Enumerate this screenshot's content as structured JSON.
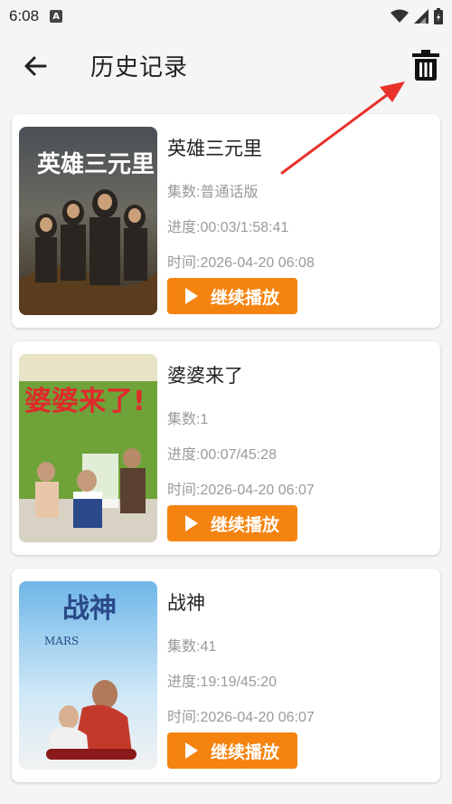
{
  "status_bar": {
    "time": "6:08",
    "notification_icon_letter": "A",
    "icons": [
      "wifi-icon",
      "signal-icon",
      "battery-icon"
    ]
  },
  "header": {
    "back_icon": "arrow-left-icon",
    "title": "历史记录",
    "delete_icon": "trash-icon"
  },
  "colors": {
    "accent": "#f5830f",
    "annotation_arrow": "#e8312b",
    "meta_text": "#9a9a9a",
    "title_text": "#222222"
  },
  "history": [
    {
      "title": "英雄三元里",
      "episodes": "集数:普通话版",
      "progress": "进度:00:03/1:58:41",
      "time": "时间:2026-04-20 06:08",
      "button_label": "继续播放",
      "poster_text": "英雄三元里"
    },
    {
      "title": "婆婆来了",
      "episodes": "集数:1",
      "progress": "进度:00:07/45:28",
      "time": "时间:2026-04-20 06:07",
      "button_label": "继续播放",
      "poster_text": "婆婆来了!"
    },
    {
      "title": "战神",
      "episodes": "集数:41",
      "progress": "进度:19:19/45:20",
      "time": "时间:2026-04-20 06:07",
      "button_label": "继续播放",
      "poster_text": "战神",
      "poster_subtext": "MARS"
    }
  ]
}
